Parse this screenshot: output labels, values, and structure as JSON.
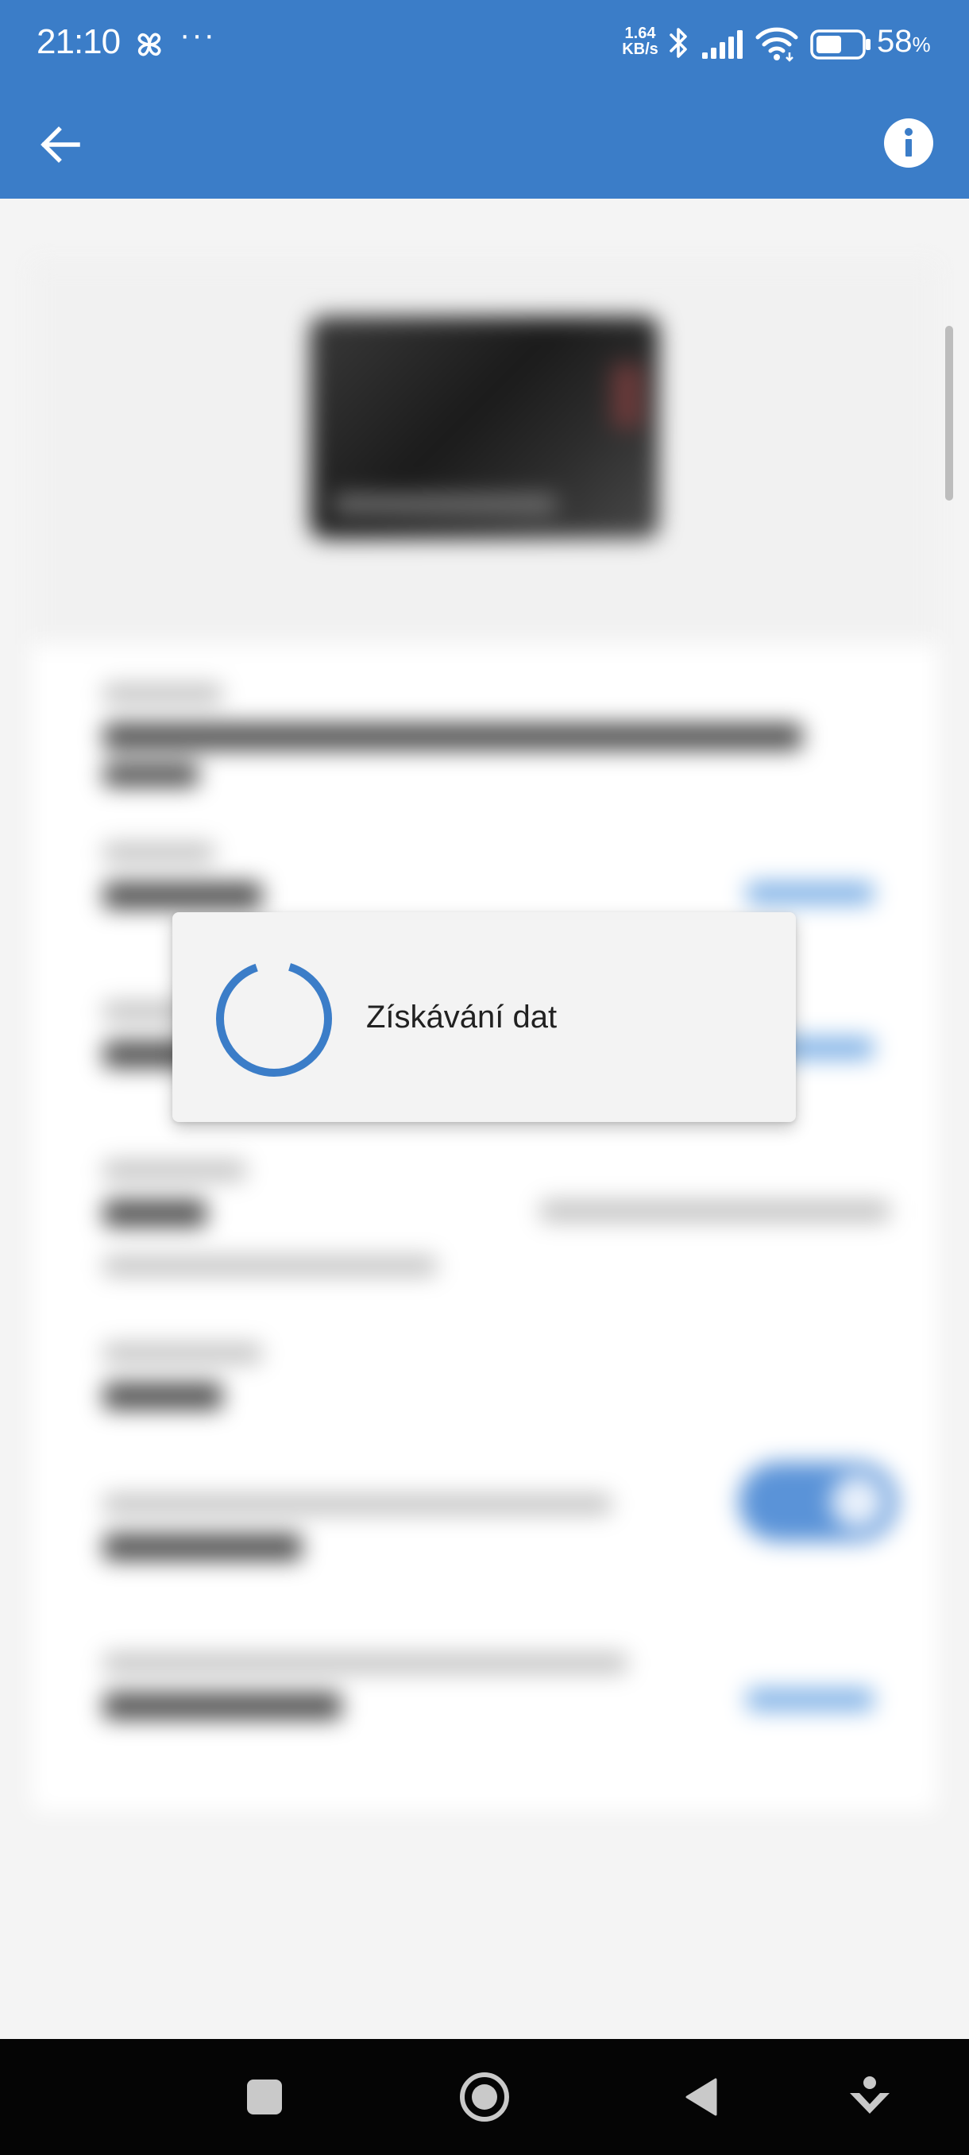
{
  "status_bar": {
    "time": "21:10",
    "dots": "···",
    "speed_value": "1.64",
    "speed_unit": "KB/s",
    "battery_value": "58",
    "battery_unit": "%",
    "battery_level": 0.58,
    "icons": [
      "fan-icon",
      "bluetooth-icon",
      "signal-icon",
      "wifi-icon",
      "battery-icon"
    ]
  },
  "app_bar": {
    "back_icon": "arrow-left-icon",
    "info_icon": "info-icon"
  },
  "dialog": {
    "message": "Získávání dat"
  },
  "nav_bar": {
    "buttons": [
      "recents-button",
      "home-button",
      "back-button",
      "assistant-button"
    ]
  },
  "colors": {
    "primary": "#3b7dc8",
    "spinner": "#3b7dc8",
    "nav_bar": "#050505",
    "dialog_bg": "#f3f3f3"
  }
}
